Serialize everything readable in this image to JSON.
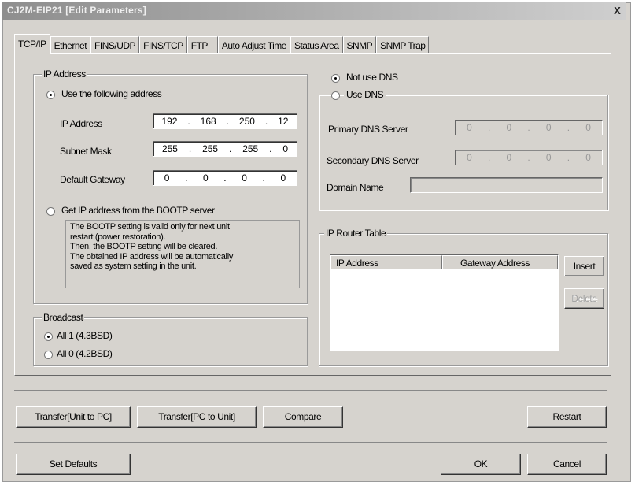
{
  "window": {
    "title": "CJ2M-EIP21 [Edit Parameters]",
    "close_label": "X"
  },
  "tabs": [
    "TCP/IP",
    "Ethernet",
    "FINS/UDP",
    "FINS/TCP",
    "FTP",
    "Auto Adjust Time",
    "Status Area",
    "SNMP",
    "SNMP Trap"
  ],
  "active_tab": "TCP/IP",
  "ip_group": {
    "title": "IP Address",
    "use_following": "Use the following address",
    "ip_label": "IP Address",
    "ip_value": [
      "192",
      "168",
      "250",
      "12"
    ],
    "mask_label": "Subnet Mask",
    "mask_value": [
      "255",
      "255",
      "255",
      "0"
    ],
    "gateway_label": "Default Gateway",
    "gateway_value": [
      "0",
      "0",
      "0",
      "0"
    ],
    "bootp_label": "Get IP address from the BOOTP server",
    "bootp_note": [
      "The BOOTP setting is valid only for next unit",
      "restart (power restoration).",
      "Then, the BOOTP setting will be cleared.",
      "The obtained IP address will be automatically",
      "saved as system setting in the unit."
    ]
  },
  "broadcast": {
    "title": "Broadcast",
    "opt1": "All 1 (4.3BSD)",
    "opt2": "All 0 (4.2BSD)"
  },
  "dns": {
    "not_use": "Not use DNS",
    "use": "Use DNS",
    "primary_label": "Primary DNS Server",
    "primary_value": [
      "0",
      "0",
      "0",
      "0"
    ],
    "secondary_label": "Secondary DNS Server",
    "secondary_value": [
      "0",
      "0",
      "0",
      "0"
    ],
    "domain_label": "Domain Name",
    "domain_value": ""
  },
  "router": {
    "title": "IP Router Table",
    "col_ip": "IP Address",
    "col_gateway": "Gateway Address",
    "insert": "Insert",
    "delete": "Delete"
  },
  "buttons": {
    "transfer_unit_pc": "Transfer[Unit to PC]",
    "transfer_pc_unit": "Transfer[PC to Unit]",
    "compare": "Compare",
    "restart": "Restart",
    "set_defaults": "Set Defaults",
    "ok": "OK",
    "cancel": "Cancel"
  }
}
